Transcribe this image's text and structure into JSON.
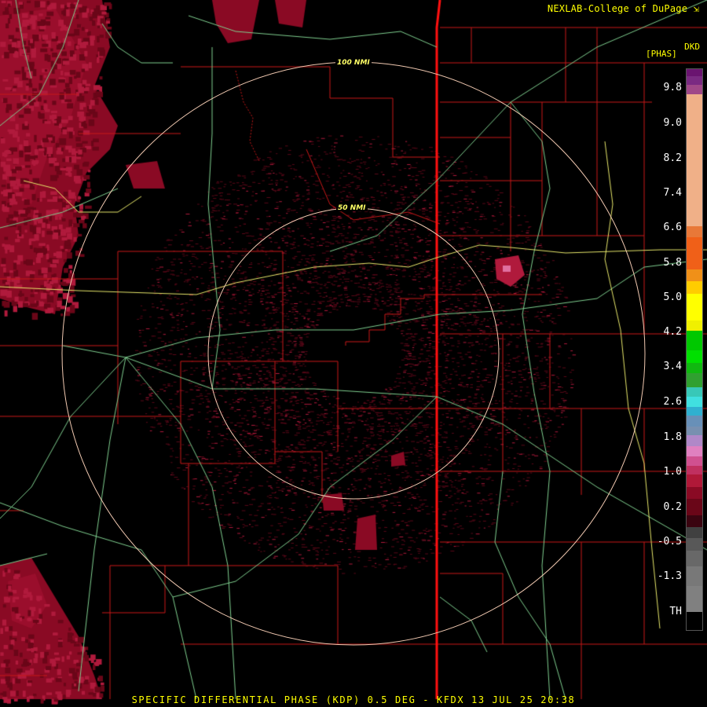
{
  "header": {
    "credit": "NEXLAB-College of DuPage",
    "credit_icon": "link-arrow-icon",
    "product_code": "DKD",
    "units": "[PHAS]"
  },
  "map": {
    "range_rings": [
      {
        "label": "100 NMI"
      },
      {
        "label": "50 NMI"
      }
    ],
    "colors": {
      "background": "#000000",
      "county_lines": "#c81818",
      "state_line": "#ff1010",
      "roads": "#7fcf8f",
      "interstate": "#e6e66a",
      "range_rings": "#f0c8b0",
      "echo_dark": "#8a0a24",
      "echo_mid": "#b01a3c",
      "echo_bright": "#e05090"
    }
  },
  "legend": {
    "ticks": [
      "9.8",
      "9.0",
      "8.2",
      "7.4",
      "6.6",
      "5.8",
      "5.0",
      "4.2",
      "3.4",
      "2.6",
      "1.8",
      "1.0",
      "0.2",
      "-0.5",
      "-1.3",
      "TH"
    ]
  },
  "footer": {
    "caption": "SPECIFIC DIFFERENTIAL PHASE (KDP) 0.5 DEG - KFDX 13 JUL 25 20:38"
  }
}
